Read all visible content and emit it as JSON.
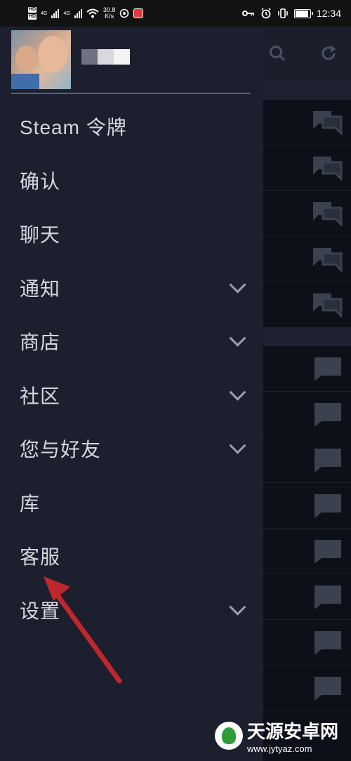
{
  "status_bar": {
    "network_gen_1": "4G",
    "network_gen_2": "4G",
    "speed_value": "30.8",
    "speed_unit": "K/s",
    "time": "12:34",
    "hd_1": "HD",
    "hd_2": "HD"
  },
  "drawer": {
    "menu": [
      {
        "label": "Steam 令牌",
        "has_chevron": false
      },
      {
        "label": "确认",
        "has_chevron": false
      },
      {
        "label": "聊天",
        "has_chevron": false
      },
      {
        "label": "通知",
        "has_chevron": true
      },
      {
        "label": "商店",
        "has_chevron": true
      },
      {
        "label": "社区",
        "has_chevron": true
      },
      {
        "label": "您与好友",
        "has_chevron": true
      },
      {
        "label": "库",
        "has_chevron": false
      },
      {
        "label": "客服",
        "has_chevron": false
      },
      {
        "label": "设置",
        "has_chevron": true
      }
    ]
  },
  "background": {
    "toolbar_icons": [
      "search-icon",
      "refresh-icon"
    ],
    "group_chat_rows": 5,
    "chat_rows": 8
  },
  "watermark": {
    "title": "天源安卓网",
    "url": "www.jytyaz.com"
  },
  "colors": {
    "drawer_bg": "#1c1f2e",
    "menu_text": "#d6d7dc",
    "arrow": "#c0272d"
  }
}
